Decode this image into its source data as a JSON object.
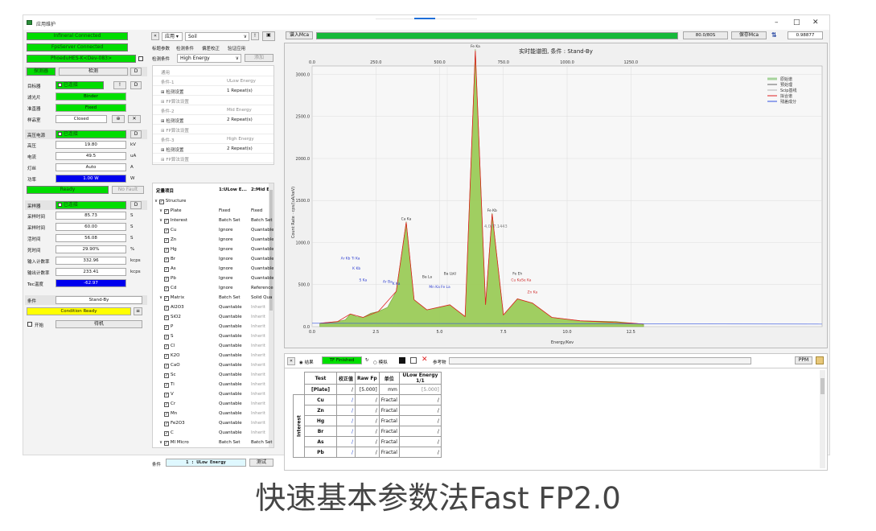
{
  "window": {
    "title": "应用维护",
    "controls": [
      "–",
      "□",
      "✕"
    ]
  },
  "left_panel": {
    "status_bars": [
      "Infineral Connected",
      "FpsServer Connected",
      "PhoeduHES-K<Dev-083>"
    ],
    "detector_section": {
      "title": "探测器",
      "button": "检测",
      "side": "D"
    },
    "target": {
      "label": "目标器",
      "state": "已连接",
      "q": "!",
      "d": "D"
    },
    "filter": {
      "label": "滤光片",
      "value": "Binder"
    },
    "collimator": {
      "label": "准直器",
      "value": "Fixed"
    },
    "sample_chamber": {
      "label": "样品室",
      "value": "Closed",
      "plus": "⊕",
      "cross": "✕"
    },
    "hv": {
      "title": "高压电源",
      "state": "已连接",
      "d": "D",
      "rows": [
        {
          "label": "高压",
          "value": "19.80",
          "unit": "kV"
        },
        {
          "label": "电流",
          "value": "49.5",
          "unit": "uA"
        },
        {
          "label": "灯丝",
          "value": "Auto",
          "unit": "A"
        },
        {
          "label": "功率",
          "value": "1.00 W",
          "unit": "W"
        }
      ],
      "ready": "Ready",
      "no_fault": "No Fault"
    },
    "acq": {
      "title": "采样器",
      "state": "已连接",
      "d": "D",
      "rows": [
        {
          "label": "采样时间",
          "value": "85.73",
          "unit": "S"
        },
        {
          "label": "采样时间",
          "value": "60.00",
          "unit": "S"
        },
        {
          "label": "活时间",
          "value": "56.08",
          "unit": "S"
        },
        {
          "label": "死时间",
          "value": "29.90%",
          "unit": "%"
        },
        {
          "label": "输入计数率",
          "value": "332.96",
          "unit": "kcps"
        },
        {
          "label": "输出计数率",
          "value": "233.41",
          "unit": "kcps"
        },
        {
          "label": "Tec温度",
          "value": "-62.97",
          "unit": ""
        }
      ]
    },
    "condition": {
      "label": "条件",
      "value": "Stand-By",
      "status": "Condition Ready"
    },
    "interlock": {
      "label": "开始",
      "button": "待机"
    }
  },
  "middle_panel": {
    "mode": "应用",
    "file": "Soil",
    "tabs": [
      "标题参数",
      "检测条件",
      "偏差校正",
      "验证应用"
    ],
    "cond_label": "检测条件",
    "cond_value": "High Energy",
    "add_button": "添加",
    "param_rows": [
      {
        "a": "通用",
        "b": "",
        "grey": true
      },
      {
        "a": "条件-1",
        "b": "ULow Energy",
        "grey": true
      },
      {
        "a": "⊞ 检测设置",
        "b": "1 Repeat(s)",
        "grey": false
      },
      {
        "a": "⊞ FP算法设置",
        "b": "",
        "grey": true
      },
      {
        "a": "条件-2",
        "b": "Mid Energy",
        "grey": true
      },
      {
        "a": "⊞ 检测设置",
        "b": "2 Repeat(s)",
        "grey": false
      },
      {
        "a": "⊞ FP算法设置",
        "b": "",
        "grey": true
      },
      {
        "a": "条件-3",
        "b": "High Energy",
        "grey": true
      },
      {
        "a": "⊞ 检测设置",
        "b": "2 Repeat(s)",
        "grey": false
      },
      {
        "a": "⊞ FP算法设置",
        "b": "",
        "grey": true
      }
    ],
    "tree_headers": [
      "定量项目",
      "1:ULow E...",
      "2:Mid En"
    ],
    "tree_rows": [
      {
        "indent": 0,
        "name": "Structure",
        "c1": "",
        "c2": ""
      },
      {
        "indent": 1,
        "name": "Plate",
        "c1": "Fixed",
        "c2": "Fixed"
      },
      {
        "indent": 1,
        "name": "Interest",
        "c1": "Batch Set",
        "c2": "Batch Set"
      },
      {
        "indent": 2,
        "name": "Cu",
        "c1": "Ignore",
        "c2": "Quantable"
      },
      {
        "indent": 2,
        "name": "Zn",
        "c1": "Ignore",
        "c2": "Quantable"
      },
      {
        "indent": 2,
        "name": "Hg",
        "c1": "Ignore",
        "c2": "Quantable"
      },
      {
        "indent": 2,
        "name": "Br",
        "c1": "Ignore",
        "c2": "Quantable"
      },
      {
        "indent": 2,
        "name": "As",
        "c1": "Ignore",
        "c2": "Quantable"
      },
      {
        "indent": 2,
        "name": "Pb",
        "c1": "Ignore",
        "c2": "Quantable"
      },
      {
        "indent": 2,
        "name": "Cd",
        "c1": "Ignore",
        "c2": "Reference"
      },
      {
        "indent": 1,
        "name": "Matrix",
        "c1": "Batch Set",
        "c2": "Solid Qua"
      },
      {
        "indent": 2,
        "name": "Al2O3",
        "c1": "Quantable",
        "c2": "Inherit"
      },
      {
        "indent": 2,
        "name": "SiO2",
        "c1": "Quantable",
        "c2": "Inherit"
      },
      {
        "indent": 2,
        "name": "P",
        "c1": "Quantable",
        "c2": "Inherit"
      },
      {
        "indent": 2,
        "name": "S",
        "c1": "Quantable",
        "c2": "Inherit"
      },
      {
        "indent": 2,
        "name": "Cl",
        "c1": "Quantable",
        "c2": "Inherit"
      },
      {
        "indent": 2,
        "name": "K2O",
        "c1": "Quantable",
        "c2": "Inherit"
      },
      {
        "indent": 2,
        "name": "CaO",
        "c1": "Quantable",
        "c2": "Inherit"
      },
      {
        "indent": 2,
        "name": "Sc",
        "c1": "Quantable",
        "c2": "Inherit"
      },
      {
        "indent": 2,
        "name": "Ti",
        "c1": "Quantable",
        "c2": "Inherit"
      },
      {
        "indent": 2,
        "name": "V",
        "c1": "Quantable",
        "c2": "Inherit"
      },
      {
        "indent": 2,
        "name": "Cr",
        "c1": "Quantable",
        "c2": "Inherit"
      },
      {
        "indent": 2,
        "name": "Mn",
        "c1": "Quantable",
        "c2": "Inherit"
      },
      {
        "indent": 2,
        "name": "Fe2O3",
        "c1": "Quantable",
        "c2": "Inherit"
      },
      {
        "indent": 2,
        "name": "C",
        "c1": "Quantable",
        "c2": "Inherit"
      },
      {
        "indent": 1,
        "name": "MI Micro",
        "c1": "Batch Set",
        "c2": "Batch Set"
      }
    ],
    "bottom_label": "条件",
    "bottom_value": "1 : ULow Energy",
    "test_button": "测试"
  },
  "right_panel": {
    "mca_label": "谱入Mca",
    "progress": 1.0,
    "count_display": "80.0/80S",
    "save_button": "保存Mca",
    "value_box": "0.98877",
    "chart_title": "实时能谱图, 条件 : Stand-By",
    "cursor_label": "4,077.1443",
    "legend": [
      {
        "name": "原始谱",
        "color": "#a6d39c"
      },
      {
        "name": "预处理",
        "color": "#666666"
      },
      {
        "name": "Scip基线",
        "color": "#b0b0b0"
      },
      {
        "name": "拟合谱",
        "color": "#e02020"
      },
      {
        "name": "残差成分",
        "color": "#3050e0"
      }
    ],
    "bottom_toolbar": {
      "radio1": "结果",
      "status": "TF Finished",
      "radio2": "模拟",
      "ref_label": "参考物",
      "ppm": "PPM"
    },
    "result_table": {
      "headers": [
        "Test",
        "校正值",
        "Raw Fp",
        "单位",
        "ULow Energy 1/1"
      ],
      "group_label": "Interest",
      "plate_row": [
        "[Plate]",
        "/",
        "[5.000]",
        "mm",
        "[5.000]"
      ],
      "rows": [
        {
          "name": "Cu",
          "unit": "Fractal"
        },
        {
          "name": "Zn",
          "unit": "Fractal"
        },
        {
          "name": "Hg",
          "unit": "Fractal"
        },
        {
          "name": "Br",
          "unit": "Fractal"
        },
        {
          "name": "As",
          "unit": "Fractal"
        },
        {
          "name": "Pb",
          "unit": "Fractal"
        }
      ]
    }
  },
  "chart_data": {
    "type": "line",
    "title": "实时能谱图, 条件 : Stand-By",
    "xlabel": "Energy/Kev",
    "ylabel": "Count Rate · cps/(uA/keV)",
    "xlim": [
      0,
      20
    ],
    "ylim": [
      0,
      3100
    ],
    "x_ticks": [
      "0.0",
      "2.5",
      "5.0",
      "7.5",
      "10.0",
      "12.5"
    ],
    "y_ticks": [
      "0.0",
      "500.0",
      "1000.0",
      "1500.0",
      "2000.0",
      "2500.0",
      "3000.0"
    ],
    "series": [
      {
        "name": "原始谱",
        "points": [
          [
            0.3,
            40
          ],
          [
            1.0,
            60
          ],
          [
            1.3,
            80
          ],
          [
            1.5,
            150
          ],
          [
            1.74,
            120
          ],
          [
            2.0,
            110
          ],
          [
            2.3,
            160
          ],
          [
            2.6,
            180
          ],
          [
            2.96,
            230
          ],
          [
            3.3,
            420
          ],
          [
            3.69,
            1250
          ],
          [
            4.0,
            320
          ],
          [
            4.5,
            200
          ],
          [
            5.0,
            230
          ],
          [
            5.4,
            260
          ],
          [
            6.0,
            120
          ],
          [
            6.4,
            3300
          ],
          [
            6.8,
            260
          ],
          [
            7.06,
            1350
          ],
          [
            7.5,
            140
          ],
          [
            8.05,
            330
          ],
          [
            8.64,
            280
          ],
          [
            9.4,
            110
          ],
          [
            10.5,
            70
          ],
          [
            11.9,
            60
          ],
          [
            12.6,
            40
          ],
          [
            13.0,
            30
          ]
        ]
      },
      {
        "name": "拟合谱",
        "points": [
          [
            0.3,
            40
          ],
          [
            1.0,
            60
          ],
          [
            1.5,
            150
          ],
          [
            2.0,
            110
          ],
          [
            2.6,
            180
          ],
          [
            3.3,
            420
          ],
          [
            3.69,
            1240
          ],
          [
            4.0,
            320
          ],
          [
            4.5,
            200
          ],
          [
            5.4,
            260
          ],
          [
            6.0,
            120
          ],
          [
            6.4,
            3280
          ],
          [
            6.8,
            260
          ],
          [
            7.06,
            1340
          ],
          [
            7.5,
            140
          ],
          [
            8.05,
            330
          ],
          [
            8.64,
            280
          ],
          [
            9.4,
            110
          ],
          [
            10.5,
            70
          ],
          [
            12.6,
            40
          ],
          [
            13.0,
            30
          ]
        ]
      }
    ],
    "peak_labels": [
      {
        "x": 6.4,
        "y": 3300,
        "text": "Fe Ka",
        "color": "#333333"
      },
      {
        "x": 7.06,
        "y": 1350,
        "text": "Fe Kb",
        "color": "#333333"
      },
      {
        "x": 3.69,
        "y": 1250,
        "text": "Ca Ka",
        "color": "#333333"
      },
      {
        "x": 4.51,
        "y": 560,
        "text": "Ba La",
        "color": "#333333"
      },
      {
        "x": 5.41,
        "y": 600,
        "text": "Ba LbU",
        "color": "#333333"
      },
      {
        "x": 8.05,
        "y": 600,
        "text": "Fe Eh",
        "color": "#333333"
      },
      {
        "x": 8.2,
        "y": 520,
        "text": "Cu KaSe Ka",
        "color": "#d03030"
      },
      {
        "x": 8.64,
        "y": 380,
        "text": "Zn Ka",
        "color": "#d03030"
      },
      {
        "x": 1.5,
        "y": 780,
        "text": "Ar Kb Ti Ka",
        "color": "#3040d0"
      },
      {
        "x": 1.74,
        "y": 660,
        "text": "K Kb",
        "color": "#3040d0"
      },
      {
        "x": 2.0,
        "y": 520,
        "text": "S Ka",
        "color": "#3040d0"
      },
      {
        "x": 2.96,
        "y": 500,
        "text": "Ar Ba",
        "color": "#3040d0"
      },
      {
        "x": 3.3,
        "y": 480,
        "text": "K Ka",
        "color": "#3040d0"
      },
      {
        "x": 5.0,
        "y": 440,
        "text": "Mn Ka Fe La",
        "color": "#3040d0"
      }
    ]
  }
}
